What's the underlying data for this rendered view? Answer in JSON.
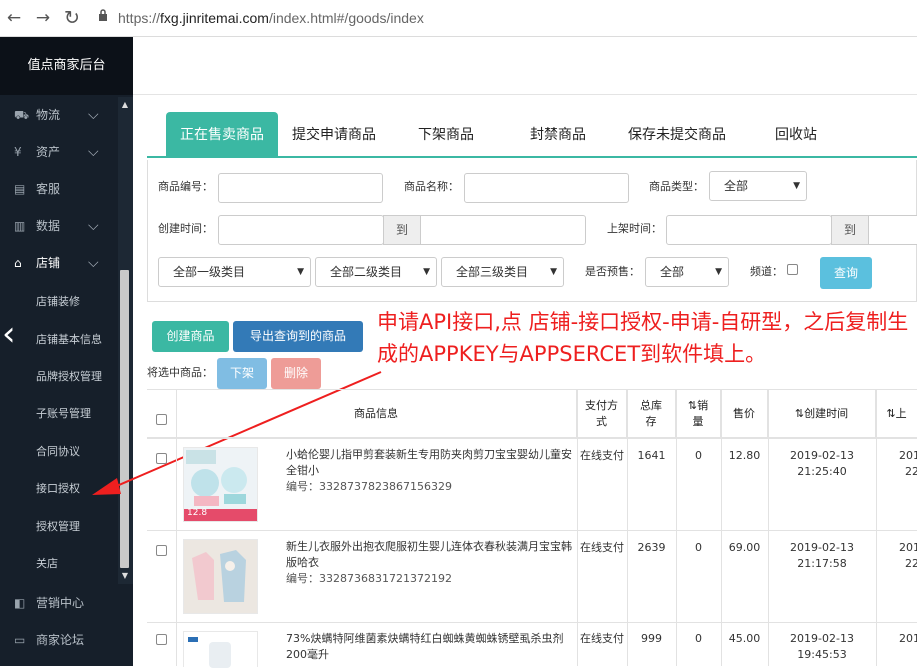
{
  "browser": {
    "back": "←",
    "forward": "→",
    "reload": "↻",
    "lock": "🔒",
    "url_prefix": "https://",
    "url_host": "fxg.jinritemai.com",
    "url_path": "/index.html#/goods/index"
  },
  "sidebar": {
    "brand": "值点商家后台",
    "items": [
      {
        "label": "物流",
        "icon": "truck-icon",
        "glyph": "⛟"
      },
      {
        "label": "资产",
        "icon": "wallet-icon",
        "glyph": "¥"
      },
      {
        "label": "客服",
        "icon": "chat-icon",
        "glyph": "▤"
      },
      {
        "label": "数据",
        "icon": "chart-icon",
        "glyph": "▥"
      },
      {
        "label": "店铺",
        "icon": "store-icon",
        "glyph": "⌂"
      }
    ],
    "sub_items": [
      "店铺装修",
      "店铺基本信息",
      "品牌授权管理",
      "子账号管理",
      "合同协议",
      "接口授权",
      "授权管理",
      "关店"
    ],
    "bottom_items": [
      {
        "label": "营销中心",
        "icon": "megaphone-icon",
        "glyph": "◧"
      },
      {
        "label": "商家论坛",
        "icon": "forum-icon",
        "glyph": "▭"
      }
    ],
    "chevron": "⌵",
    "collapse": "‹"
  },
  "tabs": [
    "正在售卖商品",
    "提交申请商品",
    "下架商品",
    "封禁商品",
    "保存未提交商品",
    "回收站"
  ],
  "filters": {
    "goods_id_label": "商品编号：",
    "goods_name_label": "商品名称：",
    "goods_type_label": "商品类型：",
    "goods_type_value": "全部",
    "create_time_label": "创建时间：",
    "to_label": "到",
    "on_shelf_label": "上架时间：",
    "cat1": "全部一级类目",
    "cat2": "全部二级类目",
    "cat3": "全部三级类目",
    "presale_label": "是否预售：",
    "presale_value": "全部",
    "channel_label": "频道：",
    "query_button": "查询"
  },
  "actions": {
    "create": "创建商品",
    "export": "导出查询到的商品",
    "selected_label": "将选中商品：",
    "off_shelf": "下架",
    "delete": "删除"
  },
  "annotation": "申请API接口,点 店铺-接口授权-申请-自研型，之后复制生成的APPKEY与APPSERCET到软件填上。",
  "table": {
    "headers": [
      "商品信息",
      "支付方式",
      "总库存",
      "⇅销量",
      "售价",
      "⇅创建时间",
      "⇅上"
    ],
    "rows": [
      {
        "name": "小蛤伦婴儿指甲剪套装新生专用防夹肉剪刀宝宝婴幼儿童安全钳小",
        "code": "编号：3328737823867156329",
        "pay": "在线支付",
        "stock": "1641",
        "sales": "0",
        "price": "12.80",
        "date": "2019-02-13",
        "time": "21:25:40",
        "next": "201",
        "next2": "22",
        "thumb_tag": "12.8"
      },
      {
        "name": "新生儿衣服外出抱衣爬服初生婴儿连体衣春秋装满月宝宝韩版哈衣",
        "code": "编号：3328736831721372192",
        "pay": "在线支付",
        "stock": "2639",
        "sales": "0",
        "price": "69.00",
        "date": "2019-02-13",
        "time": "21:17:58",
        "next": "201",
        "next2": "22",
        "thumb_tag": ""
      },
      {
        "name": "73%炔螨特阿维菌素炔螨特红白蜘蛛黄蜘蛛锈壁虱杀虫剂200毫升",
        "code": "",
        "pay": "在线支付",
        "stock": "999",
        "sales": "0",
        "price": "45.00",
        "date": "2019-02-13",
        "time": "19:45:53",
        "next": "201",
        "next2": "",
        "thumb_tag": ""
      }
    ]
  },
  "colors": {
    "accent": "#3bb8a3",
    "sidebar": "#161f2a",
    "query": "#5bc0de",
    "export": "#337ab7",
    "create": "#3bb8a3",
    "annotation": "#ee1f1f"
  }
}
